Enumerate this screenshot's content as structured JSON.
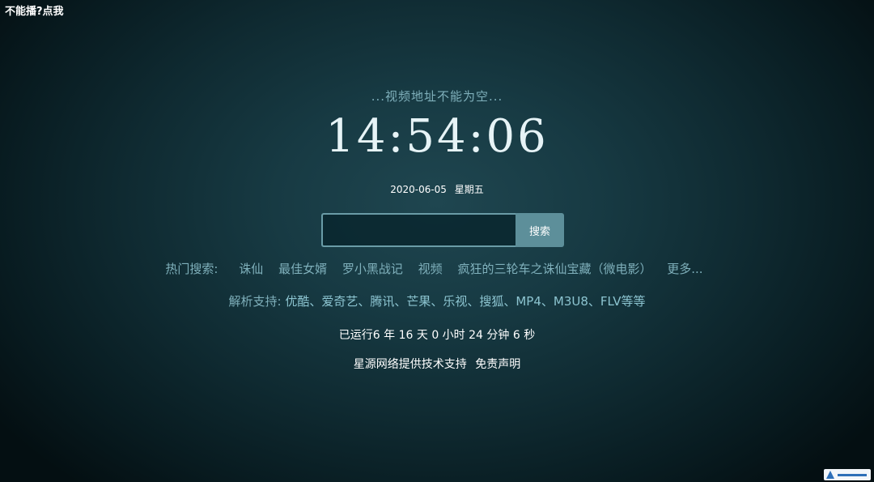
{
  "top_link": "不能播?点我",
  "notice": "...视频地址不能为空...",
  "clock": "14:54:06",
  "date": "2020-06-05",
  "weekday": "星期五",
  "search": {
    "placeholder": "",
    "button_label": "搜索"
  },
  "hot": {
    "label": "热门搜索:",
    "items": [
      "诛仙",
      "最佳女婿",
      "罗小黑战记",
      "视频",
      "疯狂的三轮车之诛仙宝藏（微电影）"
    ],
    "more": "更多..."
  },
  "parse": {
    "label": "解析支持:",
    "sites": "优酷、爱奇艺、腾讯、芒果、乐视、搜狐、MP4、M3U8、FLV等等"
  },
  "runtime": "已运行6 年 16 天 0 小时 24 分钟 6 秒",
  "footer": {
    "credit": "星源网络提供技术支持",
    "disclaimer": "免责声明"
  },
  "colors": {
    "accent_text": "#7fb0bb",
    "button_bg": "#5d8f9a",
    "background_center": "#1f4650",
    "background_edge": "#040f12"
  }
}
